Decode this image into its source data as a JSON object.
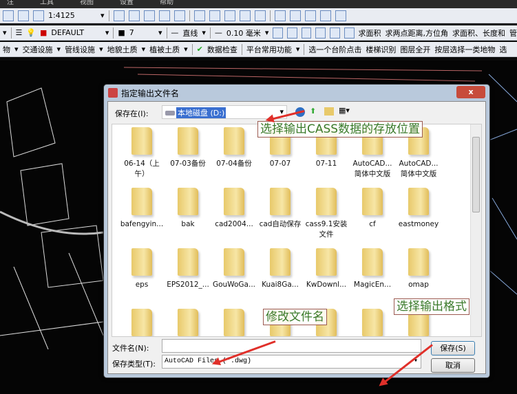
{
  "menu": [
    "注",
    "工具",
    "视图",
    "设置",
    "帮助"
  ],
  "toolbar1": {
    "scale": "1:4125"
  },
  "toolbar2": {
    "layer": "DEFAULT",
    "color": "7",
    "linetype": "直线",
    "lineweight": "0.10 毫米",
    "area": "求面积",
    "distance": "求两点距离,方位角",
    "area_len": "求面积、长度和",
    "more": "管"
  },
  "toolbar3": [
    "物",
    "交通设施",
    "管线设施",
    "地貌土质",
    "植被土质",
    "数据检查",
    "平台常用功能",
    "选一个台阶点击",
    "楼梯识别",
    "图层全开",
    "按层选择一类地物",
    "选"
  ],
  "dialog": {
    "title": "指定输出文件名",
    "save_in_label": "保存在(I):",
    "save_in_value": "本地磁盘 (D:)",
    "folders": [
      "06-14（上午）",
      "07-03备份",
      "07-04备份",
      "07-07",
      "07-11",
      "AutoCAD...简体中文版",
      "AutoCAD...简体中文版",
      "bafengyin...",
      "bak",
      "cad2004...",
      "cad自动保存",
      "cass9.1安装文件",
      "cf",
      "eastmoney",
      "eps",
      "EPS2012_...",
      "GouWoGa...",
      "Kuai8Ga...",
      "KwDownl...",
      "MagicEn...",
      "omap",
      "",
      "",
      "",
      "",
      "",
      "",
      ""
    ],
    "filename_label": "文件名(N):",
    "filename_value": "",
    "filetype_label": "保存类型(T):",
    "filetype_value": "AutoCAD Files (*.dwg)",
    "save_button": "保存(S)",
    "cancel_button": "取消",
    "close": "x"
  },
  "annotations": {
    "location": "选择输出CASS数据的存放位置",
    "filename": "修改文件名",
    "format": "选择输出格式"
  }
}
